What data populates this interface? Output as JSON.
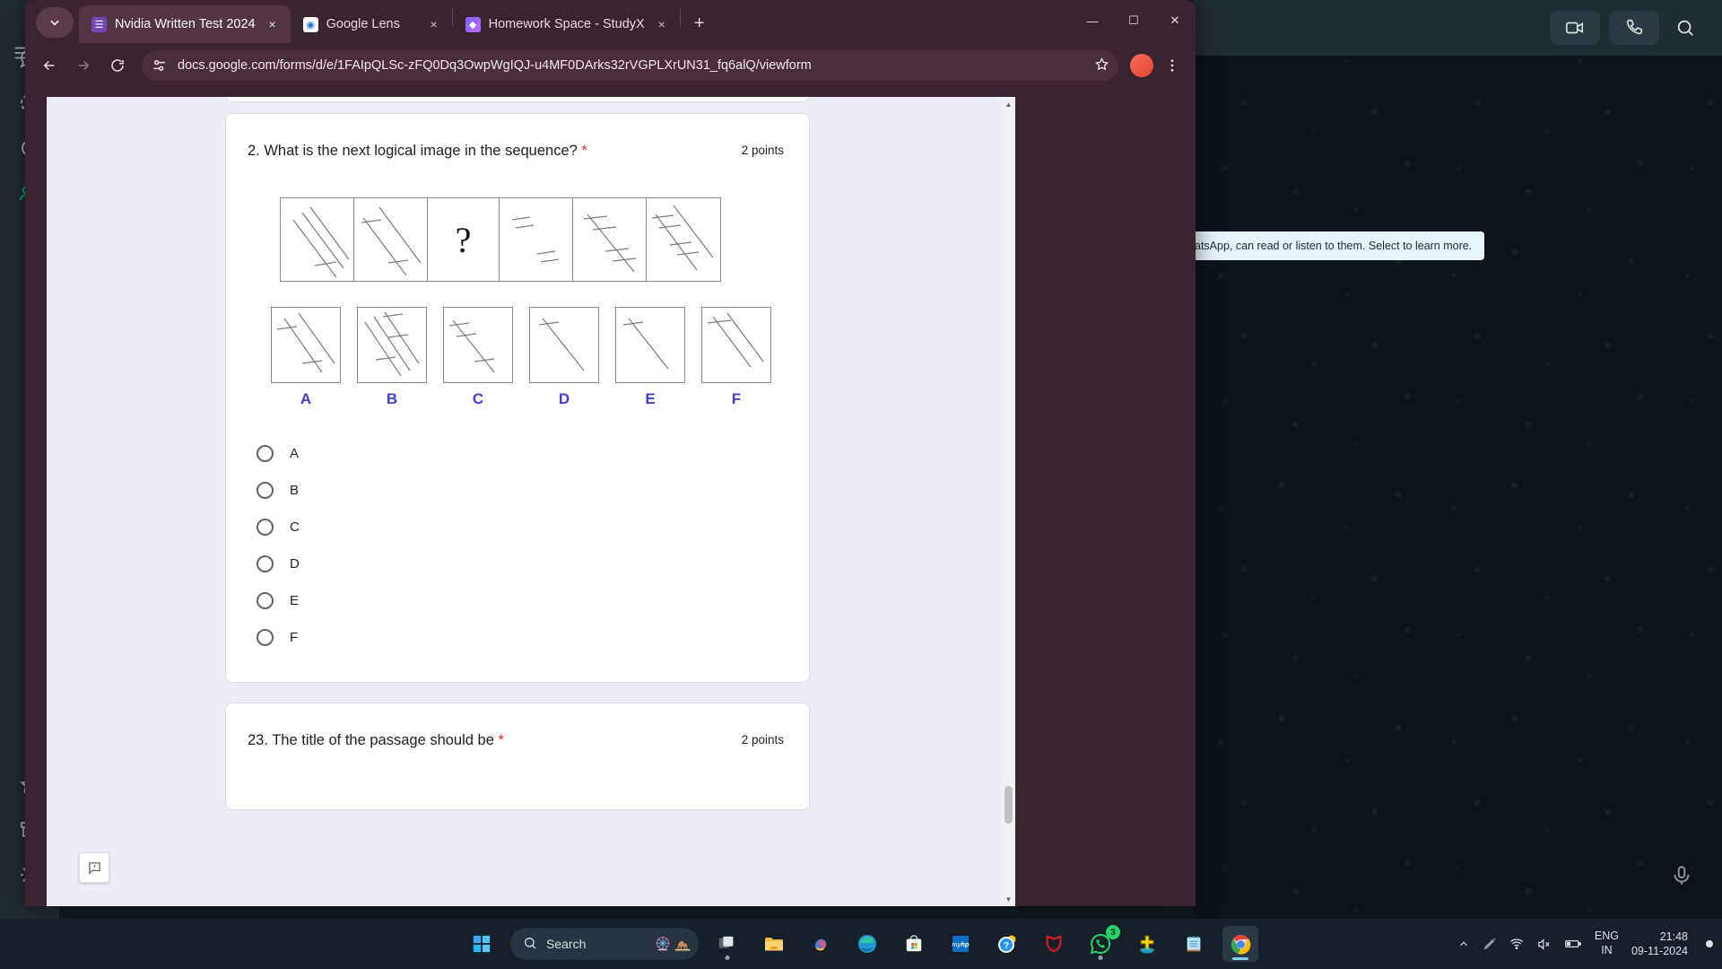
{
  "browser": {
    "tabs": [
      {
        "title": "Nvidia Written Test 2024",
        "favicon": "google-forms-icon",
        "active": true
      },
      {
        "title": "Google Lens",
        "favicon": "google-lens-icon",
        "active": false
      },
      {
        "title": "Homework Space - StudyX",
        "favicon": "studyx-icon",
        "active": false
      }
    ],
    "tab_search_label": "tab-search",
    "new_tab_label": "+",
    "close_label": "×",
    "window_controls": {
      "minimize": "—",
      "maximize": "☐",
      "close": "✕"
    },
    "toolbar": {
      "back": "back-arrow",
      "forward": "forward-arrow",
      "reload": "reload",
      "url": "docs.google.com/forms/d/e/1FAIpQLSc-zFQ0Dq3OwpWgIQJ-u4MF0DArks32rVGPLXrUN31_fq6alQ/viewform",
      "bookmark": "star",
      "profile_initial": "",
      "menu": "three-dot-menu"
    }
  },
  "form": {
    "question2": {
      "title": "2. What is the next logical image in the sequence?",
      "required_mark": "*",
      "points": "2 points",
      "sequence_placeholder": "?",
      "option_labels": [
        "A",
        "B",
        "C",
        "D",
        "E",
        "F"
      ],
      "radio_options": [
        "A",
        "B",
        "C",
        "D",
        "E",
        "F"
      ]
    },
    "question23": {
      "title": "23. The title of the passage should be",
      "required_mark": "*",
      "points": "2 points"
    },
    "feedback_icon": "feedback-icon"
  },
  "whatsapp": {
    "banner_text": "atsApp, can read or listen to them. Select to learn more.",
    "topbar": {
      "video": "video-call-icon",
      "voice": "voice-call-icon",
      "search": "search-icon"
    },
    "mic": "microphone-icon"
  },
  "taskbar": {
    "start": "windows-start-icon",
    "search_placeholder": "Search",
    "search_widget_icon": "ferris-wheel-camel-widget",
    "apps": [
      {
        "name": "task-view",
        "badge": null
      },
      {
        "name": "file-explorer",
        "badge": null
      },
      {
        "name": "copilot",
        "badge": null
      },
      {
        "name": "microsoft-edge",
        "badge": null
      },
      {
        "name": "microsoft-store",
        "badge": null
      },
      {
        "name": "myhp",
        "badge": null
      },
      {
        "name": "help-support",
        "badge": null
      },
      {
        "name": "mcafee",
        "badge": null
      },
      {
        "name": "whatsapp",
        "badge": "3"
      },
      {
        "name": "baptism-game",
        "badge": null
      },
      {
        "name": "notepad",
        "badge": null
      },
      {
        "name": "google-chrome",
        "badge": null
      }
    ],
    "tray": {
      "chevron": "show-hidden-icons",
      "pen": "pen-icon",
      "wifi": "wifi-icon",
      "volume": "volume-muted-icon",
      "battery": "battery-icon",
      "language_line1": "ENG",
      "language_line2": "IN",
      "time": "21:48",
      "date": "09-11-2024",
      "notification": "notification-dot"
    }
  }
}
